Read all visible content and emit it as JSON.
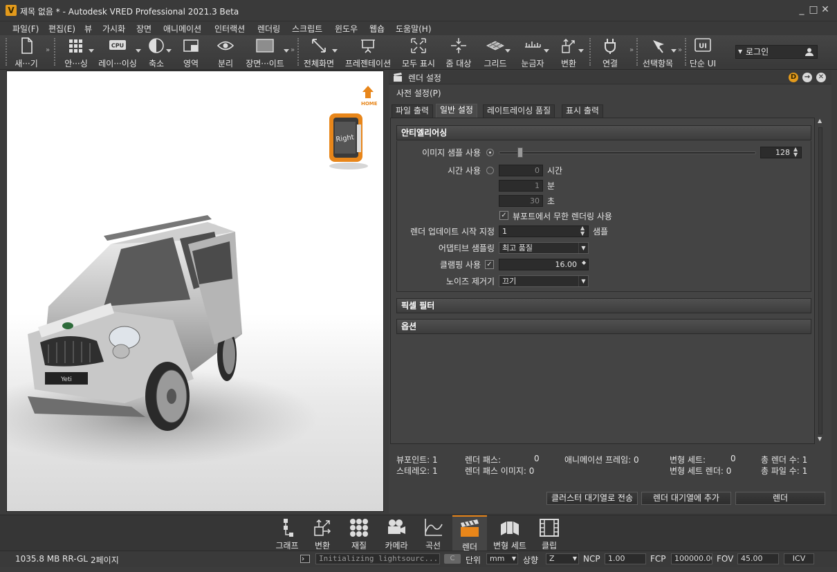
{
  "window": {
    "title": "제목 없음 * - Autodesk VRED Professional 2021.3 Beta",
    "app_icon_letter": "V",
    "minimize": "_",
    "maximize": "□",
    "close": "✕"
  },
  "menu": [
    "파일(F)",
    "편집(E)",
    "뷰",
    "가시화",
    "장면",
    "애니메이션",
    "인터랙션",
    "렌더링",
    "스크립트",
    "윈도우",
    "웹숍",
    "도움말(H)"
  ],
  "toolbar": {
    "items": [
      {
        "label": "새···기",
        "icon": "new-file-icon"
      },
      {
        "label": "안···싱",
        "icon": "shading-grid-icon"
      },
      {
        "label": "레이···이싱",
        "icon": "cpu-icon",
        "icon_text": "CPU"
      },
      {
        "label": "축소",
        "icon": "half-circle-icon"
      },
      {
        "label": "영역",
        "icon": "region-icon"
      },
      {
        "label": "분리",
        "icon": "eye-icon"
      },
      {
        "label": "장면···이트",
        "icon": "scene-plate-icon"
      },
      {
        "label": "전체화면",
        "icon": "fullscreen-icon"
      },
      {
        "label": "프레젠테이션",
        "icon": "presentation-icon"
      },
      {
        "label": "모두 표시",
        "icon": "show-all-icon"
      },
      {
        "label": "줌 대상",
        "icon": "zoom-target-icon"
      },
      {
        "label": "그리드",
        "icon": "grid-icon"
      },
      {
        "label": "눈금자",
        "icon": "ruler-icon"
      },
      {
        "label": "변환",
        "icon": "transform-icon"
      },
      {
        "label": "연결",
        "icon": "plug-icon"
      },
      {
        "label": "선택항목",
        "icon": "select-icon"
      },
      {
        "label": "단순 UI",
        "icon": "simple-ui-icon",
        "icon_text": "UI"
      }
    ],
    "login_label": "로그인"
  },
  "viewcube": {
    "home_label": "HOME",
    "face_label": "Right"
  },
  "car": {
    "plate_text": "Yeti"
  },
  "render_panel": {
    "title": "렌더 설정",
    "presets": "사전 설정(P)",
    "header_buttons": [
      "D",
      "→",
      "✕"
    ],
    "tabs": [
      "파일 출력",
      "일반 설정",
      "레이트레이싱 품질",
      "표시 출력"
    ],
    "active_tab": "일반 설정",
    "sections": {
      "antialiasing": "안티엘리어싱",
      "pixel_filter": "픽셀 필터",
      "options": "옵션"
    },
    "image_samples": {
      "label": "이미지 샘플 사용",
      "value": "128",
      "slider_fraction": 0.07
    },
    "time": {
      "label": "시간 사용",
      "hours": "0",
      "hours_unit": "시간",
      "minutes": "1",
      "minutes_unit": "분",
      "seconds": "30",
      "seconds_unit": "초"
    },
    "infinite": {
      "label": "뷰포트에서 무한 렌더링 사용",
      "checked": true
    },
    "render_update": {
      "label": "렌더 업데이트 시작 지정",
      "value": "1",
      "unit": "샘플"
    },
    "adaptive": {
      "label": "어댑티브 샘플링",
      "value": "최고 품질"
    },
    "clamping": {
      "label": "클램핑 사용",
      "value": "16.00",
      "checked": true
    },
    "denoiser": {
      "label": "노이즈 제거기",
      "value": "끄기"
    },
    "stats": {
      "viewport": "뷰포인트: 1",
      "stereo": "스테레오: 1",
      "render_pass_label": "렌더 패스:",
      "render_pass_value": "0",
      "render_pass_image": "렌더 패스 이미지: 0",
      "anim_frame": "애니메이션 프레임: 0",
      "variant_set_label": "변형 세트:",
      "variant_set_value": "0",
      "variant_set_render": "변형 세트 렌더: 0",
      "total_render": "총 렌더 수: 1",
      "total_file": "총 파일 수: 1"
    },
    "buttons": {
      "cluster": "클러스터 대기열로 전송",
      "queue": "렌더 대기열에 추가",
      "render": "렌더"
    }
  },
  "dock": [
    {
      "label": "그래프",
      "icon": "graph-icon"
    },
    {
      "label": "변환",
      "icon": "transform-dock-icon"
    },
    {
      "label": "재질",
      "icon": "material-icon"
    },
    {
      "label": "카메라",
      "icon": "camera-icon"
    },
    {
      "label": "곡선",
      "icon": "curve-icon"
    },
    {
      "label": "렌더",
      "icon": "render-clapper-icon"
    },
    {
      "label": "변형 세트",
      "icon": "variant-set-icon"
    },
    {
      "label": "클립",
      "icon": "clip-icon"
    }
  ],
  "status": {
    "memory": "1035.8 MB",
    "renderer": "RR-GL",
    "pages": "2페이지",
    "message": "Initializing lightsourc...",
    "unit_label": "단위",
    "unit_value": "mm",
    "up_label": "상향",
    "up_value": "Z",
    "ncp_label": "NCP",
    "ncp_value": "1.00",
    "fcp_label": "FCP",
    "fcp_value": "100000.00",
    "fov_label": "FOV",
    "fov_value": "45.00",
    "icv": "ICV"
  },
  "colors": {
    "accent": "#e8861a",
    "panel": "#404040",
    "background": "#3c3c3c"
  }
}
